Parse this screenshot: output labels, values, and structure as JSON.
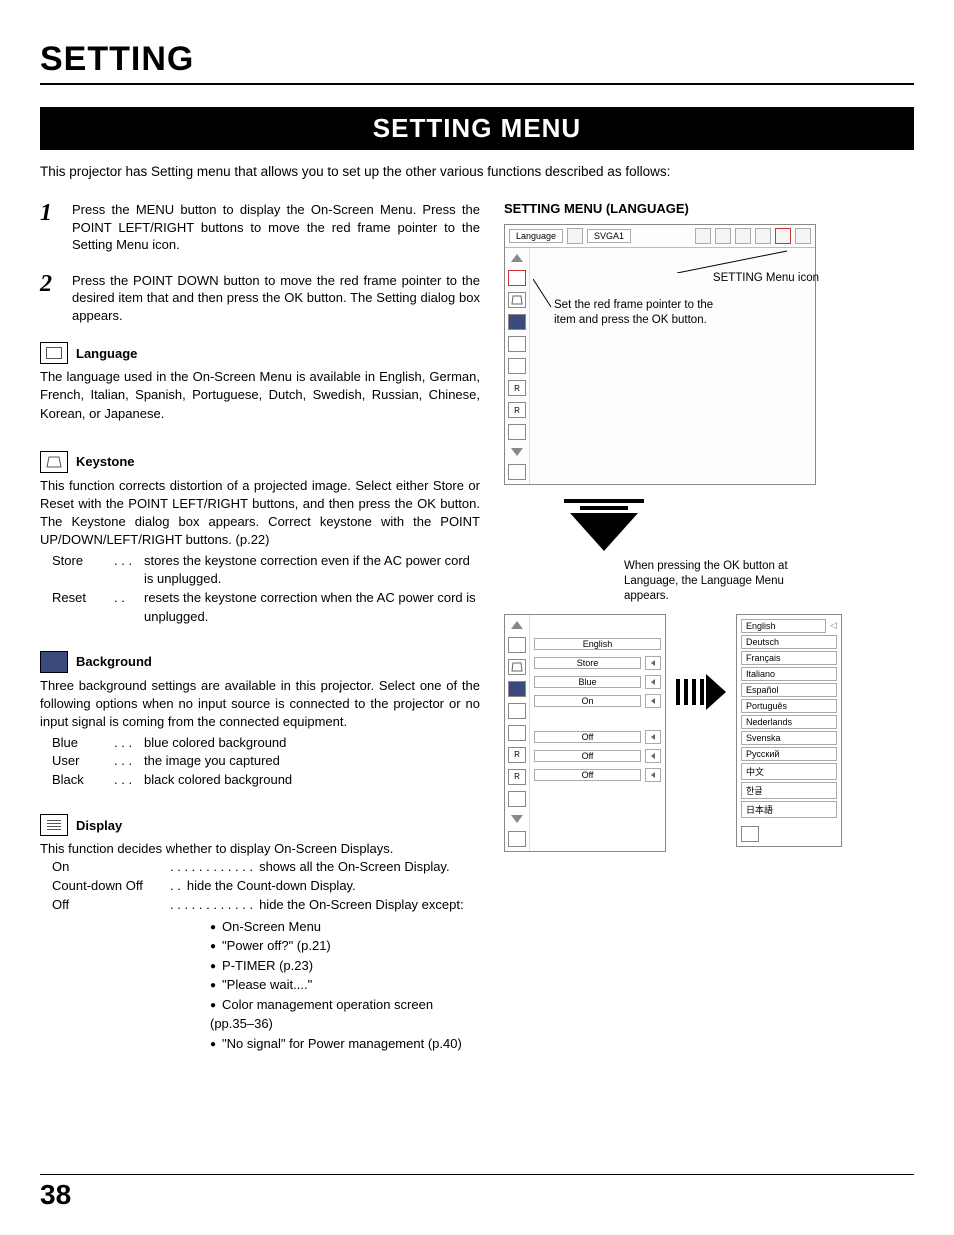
{
  "section_title": "SETTING",
  "bar_title": "SETTING MENU",
  "intro": "This projector has Setting menu that allows you to set up the other various functions described as follows:",
  "steps": [
    "Press the MENU button to display the On-Screen Menu. Press the POINT LEFT/RIGHT buttons to move the red frame pointer to the Setting Menu icon.",
    "Press the POINT DOWN button to move the red frame pointer to the desired item that and then press the OK button. The Setting dialog box appears."
  ],
  "features": {
    "language": {
      "title": "Language",
      "body": "The language used in the On-Screen Menu is available in English, German, French, Italian, Spanish, Portuguese, Dutch, Swedish, Russian, Chinese, Korean, or Japanese."
    },
    "keystone": {
      "title": "Keystone",
      "body": "This function corrects distortion of a projected image. Select either Store or Reset with the POINT LEFT/RIGHT buttons, and then press the OK button. The Keystone dialog box appears. Correct keystone with the POINT UP/DOWN/LEFT/RIGHT buttons. (p.22)",
      "items": [
        {
          "label": "Store",
          "dots": ". . .",
          "val": "stores the keystone correction even if the AC power cord is unplugged."
        },
        {
          "label": "Reset",
          "dots": ". .",
          "val": "resets the keystone correction when the AC power cord is unplugged."
        }
      ]
    },
    "background": {
      "title": "Background",
      "body": "Three background settings are available in this projector. Select one of the following options when no input source is connected to the projector or no input signal is coming from the connected equipment.",
      "items": [
        {
          "label": "Blue",
          "dots": ". . .",
          "val": "blue colored background"
        },
        {
          "label": "User",
          "dots": ". . .",
          "val": "the image you captured"
        },
        {
          "label": "Black",
          "dots": ". . .",
          "val": "black colored background"
        }
      ]
    },
    "display": {
      "title": "Display",
      "body": "This function decides whether to display On-Screen Displays.",
      "items": [
        {
          "label": "On",
          "dots": ". . . . . . . . . . . .",
          "val": "shows all the On-Screen Display."
        },
        {
          "label": "Count-down Off",
          "dots": ". .",
          "val": "hide the Count-down Display."
        },
        {
          "label": "Off",
          "dots": ". . . . . . . . . . . .",
          "val": "hide the On-Screen Display except:"
        }
      ],
      "bullets": [
        "On-Screen Menu",
        "\"Power off?\" (p.21)",
        "P-TIMER (p.23)",
        "\"Please wait....\"",
        "Color management operation screen (pp.35–36)",
        "\"No signal\" for Power management (p.40)"
      ]
    }
  },
  "right": {
    "heading": "SETTING MENU (LANGUAGE)",
    "topbar_label": "Language",
    "topbar_mode": "SVGA1",
    "callout_icon": "SETTING Menu icon",
    "callout_pointer": "Set the red frame pointer to the item and press the OK button.",
    "note": "When pressing the OK button at Language, the Language Menu appears.",
    "setting_values": [
      "English",
      "Store",
      "Blue",
      "On",
      "",
      "Off",
      "Off",
      "Off"
    ],
    "languages": [
      "English",
      "Deutsch",
      "Français",
      "Italiano",
      "Español",
      "Português",
      "Nederlands",
      "Svenska",
      "Русский",
      "中文",
      "한글",
      "日本語"
    ]
  },
  "page_number": "38"
}
